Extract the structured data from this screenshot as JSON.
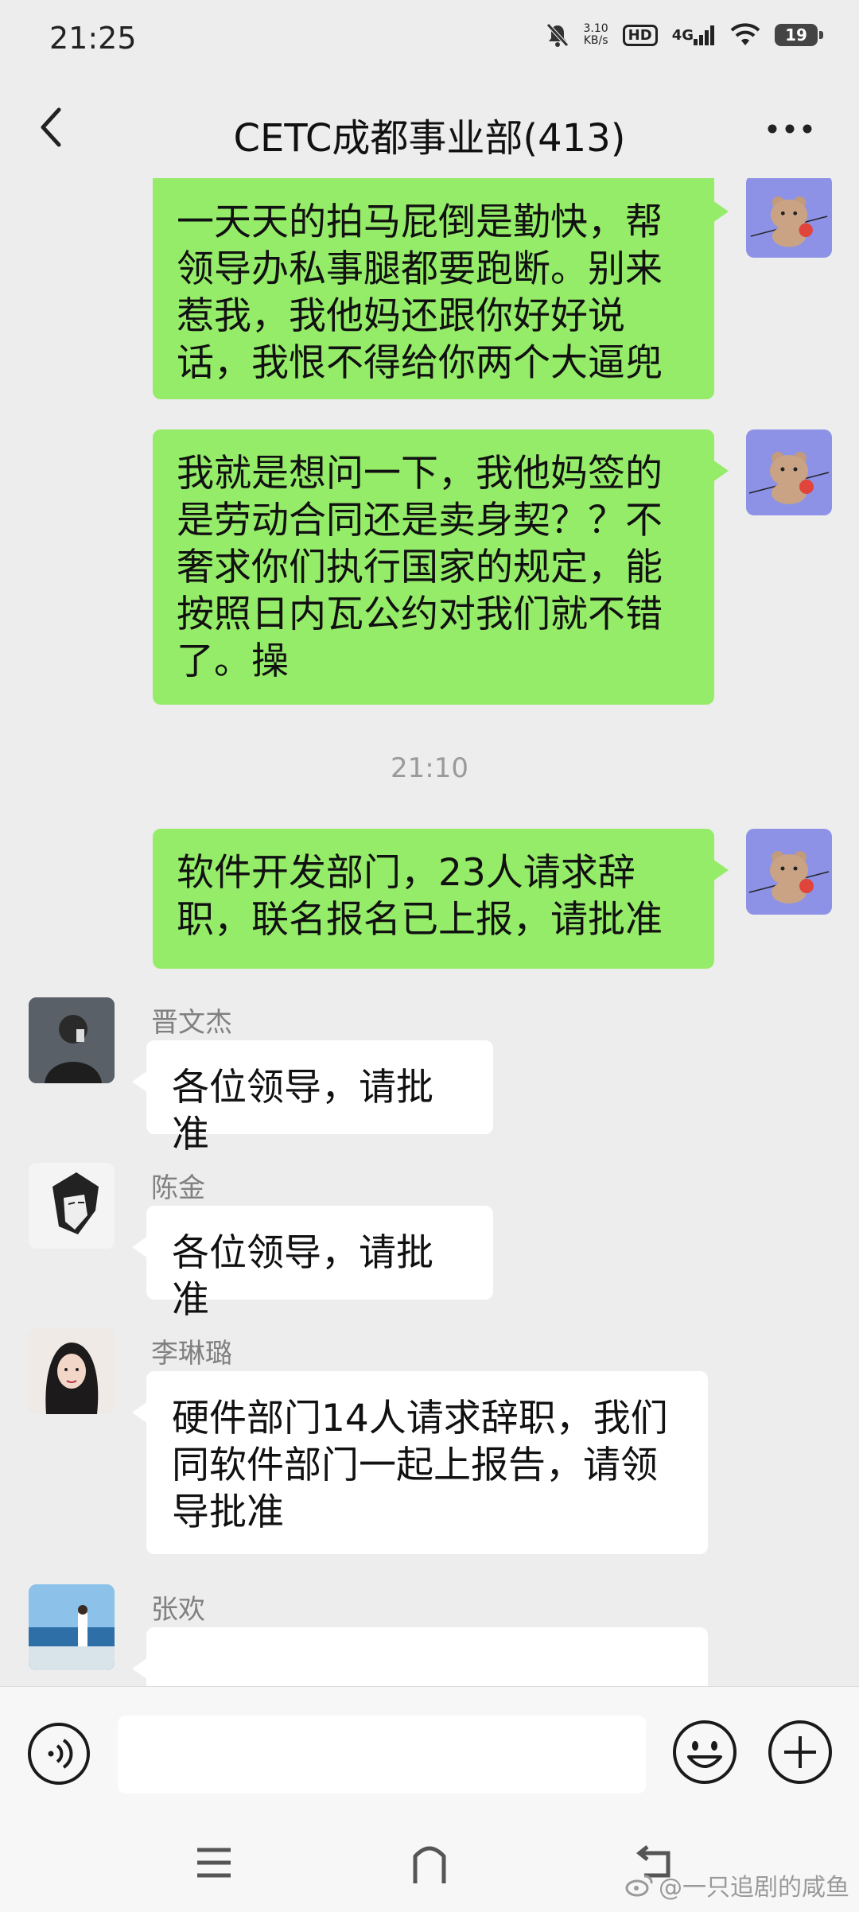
{
  "status_bar": {
    "time": "21:25",
    "net_speed_value": "3.10",
    "net_speed_unit": "KB/s",
    "hd": "HD",
    "network": "4G",
    "battery": "19"
  },
  "nav": {
    "title": "CETC成都事业部(413)"
  },
  "messages": {
    "m1": {
      "text": "一天天的拍马屁倒是勤快，帮领导办私事腿都要跑断。别来惹我，我他妈还跟你好好说话，我恨不得给你两个大逼兜"
    },
    "m2": {
      "text": "我就是想问一下，我他妈签的是劳动合同还是卖身契？？不奢求你们执行国家的规定，能按照日内瓦公约对我们就不错了。操"
    },
    "timestamp": "21:10",
    "m3": {
      "text": "软件开发部门，23人请求辞职，联名报名已上报，请批准"
    },
    "m4": {
      "sender": "晋文杰",
      "text": "各位领导，请批准"
    },
    "m5": {
      "sender": "陈金",
      "text": "各位领导，请批准"
    },
    "m6": {
      "sender": "李琳璐",
      "text": "硬件部门14人请求辞职，我们同软件部门一起上报告，请领导批准"
    },
    "m7": {
      "sender": "张欢",
      "text": ""
    }
  },
  "watermark": "@一只追剧的咸鱼",
  "colors": {
    "outgoing_bubble": "#95ec69",
    "incoming_bubble": "#ffffff",
    "chat_background": "#ededed",
    "my_avatar": "#8d92e6"
  },
  "icons": {
    "back": "chevron-left-icon",
    "more": "more-dots-icon",
    "voice": "voice-icon",
    "emoji": "emoji-icon",
    "plus": "plus-icon"
  }
}
